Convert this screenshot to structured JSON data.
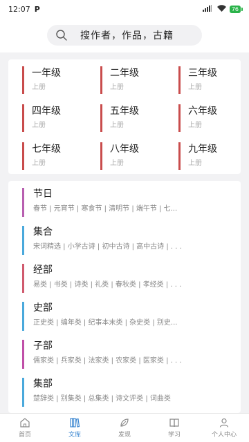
{
  "status_bar": {
    "time": "12:07",
    "app_badge": "P",
    "battery": "76"
  },
  "search": {
    "placeholder": "搜作者，作品，古籍"
  },
  "grades": [
    {
      "title": "一年级",
      "sub": "上册"
    },
    {
      "title": "二年级",
      "sub": "上册"
    },
    {
      "title": "三年级",
      "sub": "上册"
    },
    {
      "title": "四年级",
      "sub": "上册"
    },
    {
      "title": "五年级",
      "sub": "上册"
    },
    {
      "title": "六年级",
      "sub": "上册"
    },
    {
      "title": "七年级",
      "sub": "上册"
    },
    {
      "title": "八年级",
      "sub": "上册"
    },
    {
      "title": "九年级",
      "sub": "上册"
    }
  ],
  "categories": [
    {
      "title": "节日",
      "desc": "春节 | 元宵节 | 寒食节 | 清明节 | 端午节 | 七...",
      "color": "#b85fb0"
    },
    {
      "title": "集合",
      "desc": "宋词精选 | 小学古诗 | 初中古诗 | 高中古诗 | . . .",
      "color": "#4aa9dc"
    },
    {
      "title": "经部",
      "desc": "易类 | 书类 | 诗类 | 礼类 | 春秋类 | 孝经类 | . . .",
      "color": "#d05a6e"
    },
    {
      "title": "史部",
      "desc": "正史类 | 编年类 | 纪事本末类 | 杂史类 | 别史...",
      "color": "#4aa9dc"
    },
    {
      "title": "子部",
      "desc": "儒家类 | 兵家类 | 法家类 | 农家类 | 医家类 | . . .",
      "color": "#c04fa8"
    },
    {
      "title": "集部",
      "desc": "楚辞类 | 别集类 | 总集类 | 诗文评类 | 词曲类",
      "color": "#4aa9dc"
    }
  ],
  "nav": [
    {
      "label": "首页",
      "icon": "home-icon"
    },
    {
      "label": "文库",
      "icon": "library-icon"
    },
    {
      "label": "发现",
      "icon": "discover-icon"
    },
    {
      "label": "学习",
      "icon": "book-icon"
    },
    {
      "label": "个人中心",
      "icon": "user-icon"
    }
  ],
  "colors": {
    "grade_accent": "#c94c4c",
    "nav_active": "#3a86d0",
    "nav_inactive": "#888888"
  }
}
